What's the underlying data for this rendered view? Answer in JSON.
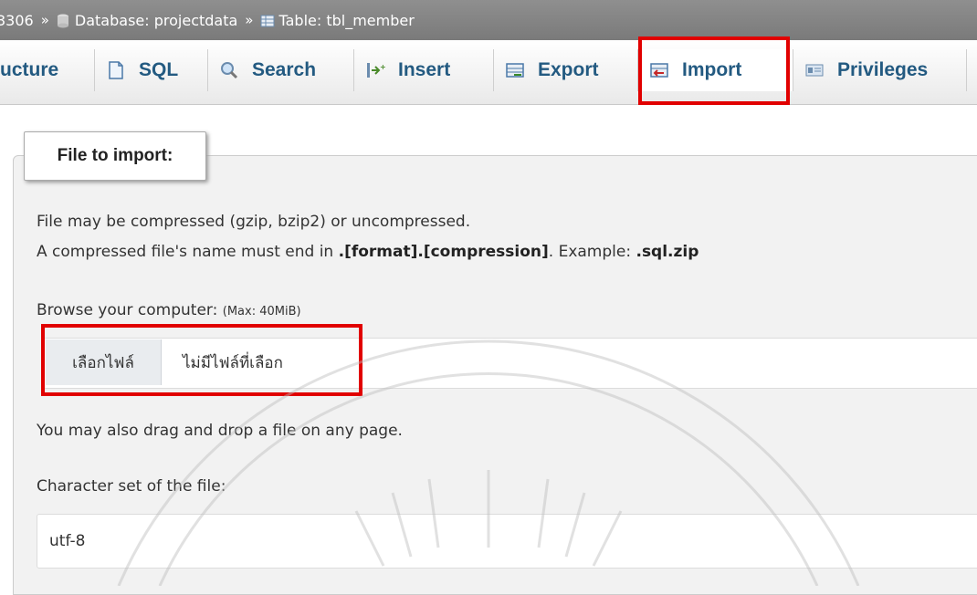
{
  "breadcrumb": {
    "server": "3306",
    "separator": "»",
    "database": "Database: projectdata",
    "table": "Table: tbl_member"
  },
  "tabs": [
    {
      "label": "ucture",
      "icon": "structure-icon"
    },
    {
      "label": "SQL",
      "icon": "sql-icon"
    },
    {
      "label": "Search",
      "icon": "search-icon"
    },
    {
      "label": "Insert",
      "icon": "insert-icon"
    },
    {
      "label": "Export",
      "icon": "export-icon"
    },
    {
      "label": "Import",
      "icon": "import-icon",
      "active": true
    },
    {
      "label": "Privileges",
      "icon": "privileges-icon"
    }
  ],
  "import": {
    "legend": "File to import:",
    "compress_line1": "File may be compressed (gzip, bzip2) or uncompressed.",
    "compress_line2_prefix": "A compressed file's name must end in ",
    "compress_line2_format": ".[format].[compression]",
    "compress_line2_mid": ". Example: ",
    "compress_line2_example": ".sql.zip",
    "browse_label": "Browse your computer: ",
    "browse_max": "(Max: 40MiB)",
    "choose_file_button": "เลือกไฟล์",
    "no_file_chosen": "ไม่มีไฟล์ที่เลือก",
    "drag_drop_hint": "You may also drag and drop a file on any page.",
    "charset_label": "Character set of the file:",
    "charset_value": "utf-8"
  },
  "colors": {
    "tab_text": "#235a81",
    "highlight_box": "#e10000",
    "breadcrumb_bg": "#858585"
  }
}
